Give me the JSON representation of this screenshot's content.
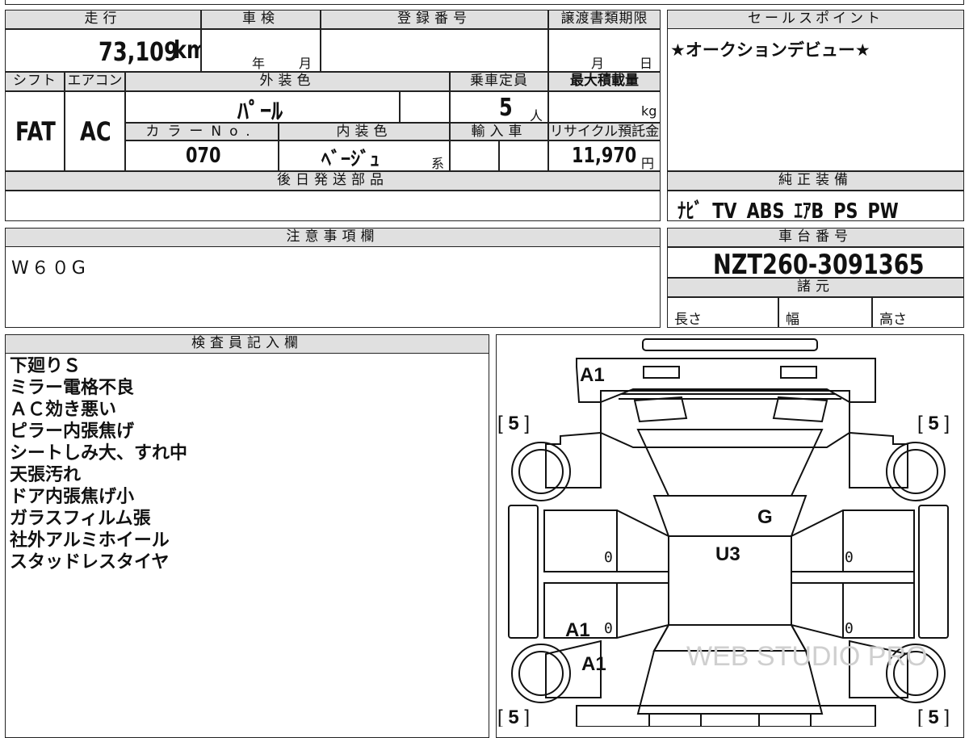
{
  "mileage": {
    "label": "走行",
    "value": "73,109",
    "unit": "km"
  },
  "inspection": {
    "label": "車検",
    "year_unit": "年",
    "month_unit": "月"
  },
  "registration": {
    "label": "登録番号",
    "value": ""
  },
  "transfer_deadline": {
    "label": "譲渡書類期限",
    "month_unit": "月",
    "day_unit": "日"
  },
  "sales_point": {
    "label": "セールスポイント",
    "value": "★オークションデビュー★"
  },
  "shift": {
    "label": "シフト",
    "value": "FAT"
  },
  "aircon": {
    "label": "エアコン",
    "value": "AC"
  },
  "exterior_color": {
    "label": "外装色",
    "value": "ﾊﾟｰﾙ"
  },
  "capacity": {
    "label": "乗車定員",
    "value": "5",
    "unit": "人"
  },
  "max_load": {
    "label": "最大積載量",
    "unit": "kg"
  },
  "color_no": {
    "label": "カラーNo.",
    "value": "070"
  },
  "interior_color": {
    "label": "内装色",
    "value": "ﾍﾞｰｼﾞｭ",
    "suffix": "系"
  },
  "import": {
    "label": "輸入車"
  },
  "recycle": {
    "label": "リサイクル預託金",
    "value": "11,970",
    "unit": "円"
  },
  "later_parts": {
    "label": "後日発送部品",
    "value": ""
  },
  "genuine_equipment": {
    "label": "純正装備",
    "value": "ﾅﾋﾞ TV ABS ｴｱB PS PW"
  },
  "caution": {
    "label": "注意事項欄",
    "value": "W６０G"
  },
  "chassis": {
    "label": "車台番号",
    "value": "NZT260-3091365"
  },
  "specs": {
    "label": "諸元",
    "length": "長さ",
    "width": "幅",
    "height": "高さ"
  },
  "inspector": {
    "label": "検査員記入欄",
    "lines": [
      "下廻りＳ",
      "ミラー電格不良",
      "ＡＣ効き悪い",
      "ピラー内張焦げ",
      "シートしみ大、すれ中",
      "天張汚れ",
      "ドア内張焦げ小",
      "ガラスフィルム張",
      "社外アルミホイール",
      "スタッドレスタイヤ"
    ]
  },
  "diagram": {
    "marks": {
      "front_bumper": "A1",
      "rear_left_door": "A1",
      "rear_left_fender": "A1",
      "roof": "U3",
      "windshield": "G"
    },
    "tire_tread": {
      "front_left": "5",
      "front_right": "5",
      "rear_left": "5",
      "rear_right": "5"
    },
    "door_zeros": [
      "0",
      "0",
      "0",
      "0"
    ],
    "watermark": "WEB STUDIO PRO"
  }
}
